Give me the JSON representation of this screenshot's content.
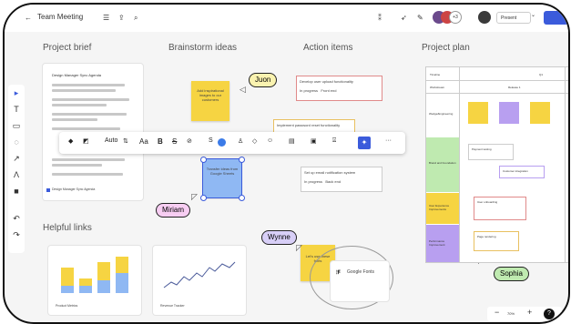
{
  "topbar": {
    "board_title": "Team Meeting",
    "present_label": "Present",
    "avatar_extra_count": "+3"
  },
  "sections": {
    "project_brief": "Project brief",
    "brainstorm": "Brainstorm ideas",
    "action_items": "Action items",
    "project_plan": "Project plan",
    "helpful_links": "Helpful links"
  },
  "brief_card": {
    "heading": "Design Manager Sync Agenda",
    "footer": "Design Manager Sync Agenda"
  },
  "stickies": {
    "yellow_top": "Add inspirational images to our customers",
    "blue_selected": "Transfer ideas from Google Sheets",
    "yellow_bottom": "Let's use these fonts"
  },
  "bubbles": {
    "juon": "Juon",
    "miriam": "Miriam",
    "wynne": "Wynne",
    "sophia": "Sophia"
  },
  "action_cards": [
    {
      "title": "Develop user upload functionality",
      "tags": [
        "In progress",
        "Front end"
      ]
    },
    {
      "title": "Implement password reset functionality",
      "tags": []
    },
    {
      "title": "Set up email notification system",
      "tags": [
        "In progress",
        "Back end"
      ]
    }
  ],
  "toolbar": {
    "font_label": "Auto",
    "text_label": "Aa",
    "bold_label": "B",
    "strike_label": "S",
    "size_label": "S"
  },
  "links": {
    "product_metrics": "Product Metrics",
    "revenue_tracker": "Revenue Tracker",
    "google_fonts": "Google Fonts"
  },
  "plan": {
    "column_headers": [
      "Timeline",
      "Q1"
    ],
    "row_labels": [
      "Workstream",
      "Wedge/Engineering",
      "Brand and Foundation",
      "User Experience Improvements",
      "Performance Improvement"
    ],
    "sub_header": "Release 1",
    "cards": [
      "Payment testing",
      "Customer integration",
      "User onboarding",
      "Page rendering"
    ]
  },
  "zoom": {
    "level": "70%",
    "help": "?"
  },
  "chart_colors": {
    "yellow": "#f6d442",
    "blue": "#8fb8f3",
    "line": "#4a5a9a"
  }
}
